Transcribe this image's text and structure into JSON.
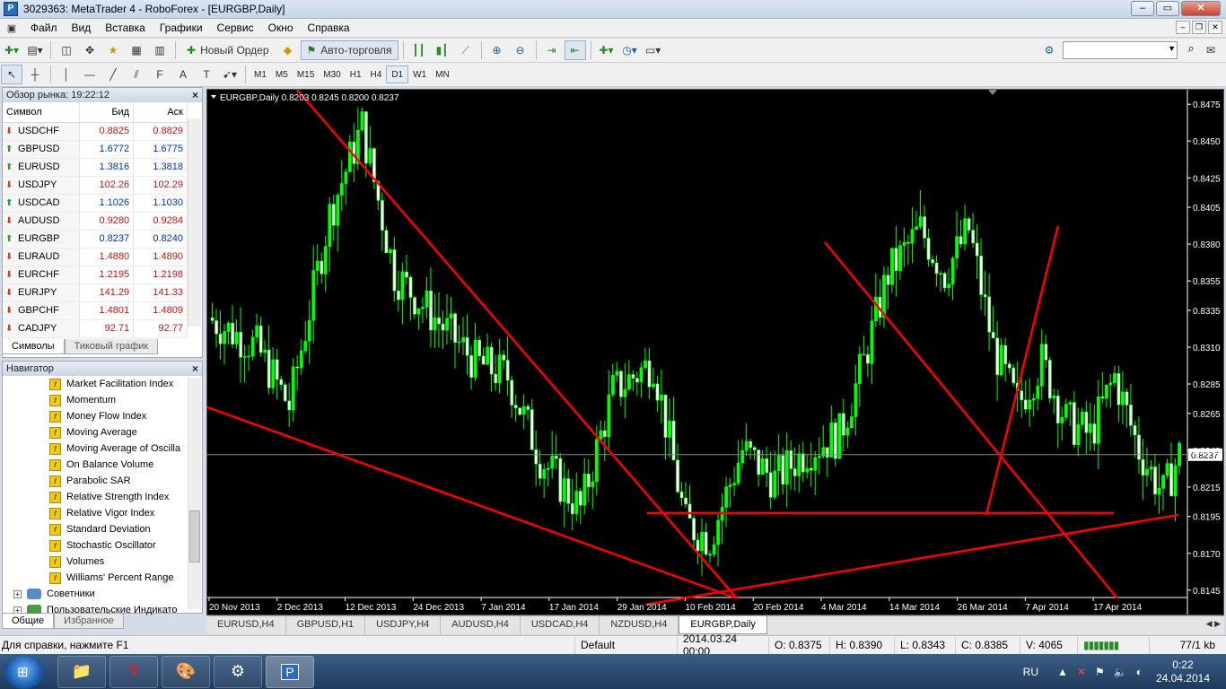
{
  "window": {
    "title": "3029363: MetaTrader 4 - RoboForex - [EURGBP,Daily]",
    "app_icon": "metatrader-icon"
  },
  "menu": [
    "Файл",
    "Вид",
    "Вставка",
    "Графики",
    "Сервис",
    "Окно",
    "Справка"
  ],
  "toolbar": {
    "new_order": "Новый Ордер",
    "autotrading": "Авто-торговля"
  },
  "timeframes": [
    "M1",
    "M5",
    "M15",
    "M30",
    "H1",
    "H4",
    "D1",
    "W1",
    "MN"
  ],
  "active_timeframe": "D1",
  "market_watch": {
    "title": "Обзор рынка: 19:22:12",
    "headers": {
      "symbol": "Символ",
      "bid": "Бид",
      "ask": "Аск"
    },
    "rows": [
      {
        "symbol": "USDCHF",
        "bid": "0.8825",
        "ask": "0.8829",
        "dir": "down"
      },
      {
        "symbol": "GBPUSD",
        "bid": "1.6772",
        "ask": "1.6775",
        "dir": "up"
      },
      {
        "symbol": "EURUSD",
        "bid": "1.3816",
        "ask": "1.3818",
        "dir": "up"
      },
      {
        "symbol": "USDJPY",
        "bid": "102.26",
        "ask": "102.29",
        "dir": "down"
      },
      {
        "symbol": "USDCAD",
        "bid": "1.1026",
        "ask": "1.1030",
        "dir": "up"
      },
      {
        "symbol": "AUDUSD",
        "bid": "0.9280",
        "ask": "0.9284",
        "dir": "down"
      },
      {
        "symbol": "EURGBP",
        "bid": "0.8237",
        "ask": "0.8240",
        "dir": "up"
      },
      {
        "symbol": "EURAUD",
        "bid": "1.4880",
        "ask": "1.4890",
        "dir": "down"
      },
      {
        "symbol": "EURCHF",
        "bid": "1.2195",
        "ask": "1.2198",
        "dir": "down"
      },
      {
        "symbol": "EURJPY",
        "bid": "141.29",
        "ask": "141.33",
        "dir": "down"
      },
      {
        "symbol": "GBPCHF",
        "bid": "1.4801",
        "ask": "1.4809",
        "dir": "down"
      },
      {
        "symbol": "CADJPY",
        "bid": "92.71",
        "ask": "92.77",
        "dir": "down"
      }
    ],
    "tabs": [
      "Символы",
      "Тиковый график"
    ]
  },
  "navigator": {
    "title": "Навигатор",
    "indicators": [
      "Market Facilitation Index",
      "Momentum",
      "Money Flow Index",
      "Moving Average",
      "Moving Average of Oscilla",
      "On Balance Volume",
      "Parabolic SAR",
      "Relative Strength Index",
      "Relative Vigor Index",
      "Standard Deviation",
      "Stochastic Oscillator",
      "Volumes",
      "Williams' Percent Range"
    ],
    "folders": [
      "Советники",
      "Пользовательские Индикато"
    ],
    "tabs": [
      "Общие",
      "Избранное"
    ]
  },
  "chart": {
    "header": "EURGBP,Daily  0.8203 0.8245 0.8200 0.8237",
    "current_price": "0.8237",
    "price_labels": [
      "0.8475",
      "0.8450",
      "0.8425",
      "0.8405",
      "0.8380",
      "0.8355",
      "0.8335",
      "0.8310",
      "0.8285",
      "0.8265",
      "0.8240",
      "0.8215",
      "0.8195",
      "0.8170",
      "0.8145"
    ],
    "date_labels": [
      "20 Nov 2013",
      "2 Dec 2013",
      "12 Dec 2013",
      "24 Dec 2013",
      "7 Jan 2014",
      "17 Jan 2014",
      "29 Jan 2014",
      "10 Feb 2014",
      "20 Feb 2014",
      "4 Mar 2014",
      "14 Mar 2014",
      "26 Mar 2014",
      "7 Apr 2014",
      "17 Apr 2014"
    ]
  },
  "chart_tabs": [
    "EURUSD,H4",
    "GBPUSD,H1",
    "USDJPY,H4",
    "AUDUSD,H4",
    "USDCAD,H4",
    "NZDUSD,H4",
    "EURGBP,Daily"
  ],
  "active_chart_tab": "EURGBP,Daily",
  "status": {
    "help": "Для справки, нажмите F1",
    "profile": "Default",
    "datetime": "2014.03.24 00:00",
    "open": "O: 0.8375",
    "high": "H: 0.8390",
    "low": "L: 0.8343",
    "close": "C: 0.8385",
    "volume": "V: 4065",
    "traffic": "77/1 kb"
  },
  "taskbar": {
    "lang": "RU",
    "time": "0:22",
    "date": "24.04.2014"
  },
  "colors": {
    "bull": "#00ff00",
    "bear": "#ffffff",
    "trendline": "#ff0000",
    "background": "#000000"
  }
}
